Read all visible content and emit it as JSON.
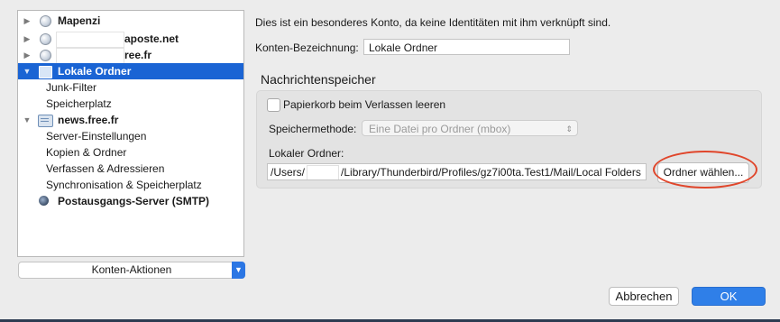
{
  "sidebar": {
    "accounts": [
      {
        "label": "Mapenzi"
      },
      {
        "label": "aposte.net"
      },
      {
        "label": "ree.fr"
      },
      {
        "label": "Lokale Ordner"
      }
    ],
    "local_children": [
      "Junk-Filter",
      "Speicherplatz"
    ],
    "news": {
      "label": "news.free.fr",
      "children": [
        "Server-Einstellungen",
        "Kopien & Ordner",
        "Verfassen & Adressieren",
        "Synchronisation & Speicherplatz"
      ]
    },
    "smtp": {
      "label": "Postausgangs-Server (SMTP)"
    }
  },
  "account_actions": {
    "label": "Konten-Aktionen"
  },
  "main": {
    "info": "Dies ist ein besonderes Konto, da keine Identitäten mit ihm verknüpft sind.",
    "account_name_label": "Konten-Bezeichnung:",
    "account_name_value": "Lokale Ordner",
    "storage": {
      "title": "Nachrichtenspeicher",
      "empty_trash_label": "Papierkorb beim Verlassen leeren",
      "empty_trash_checked": false,
      "method_label": "Speichermethode:",
      "method_value": "Eine Datei pro Ordner (mbox)",
      "local_dir_label": "Lokaler Ordner:",
      "path_prefix": "/Users/",
      "path_suffix": "/Library/Thunderbird/Profiles/gz7i00ta.Test1/Mail/Local Folders",
      "choose_button": "Ordner wählen..."
    }
  },
  "footer": {
    "cancel": "Abbrechen",
    "ok": "OK"
  },
  "colors": {
    "selection": "#1a64d4",
    "accent": "#2f7fe8",
    "annotation": "#e0462b"
  }
}
